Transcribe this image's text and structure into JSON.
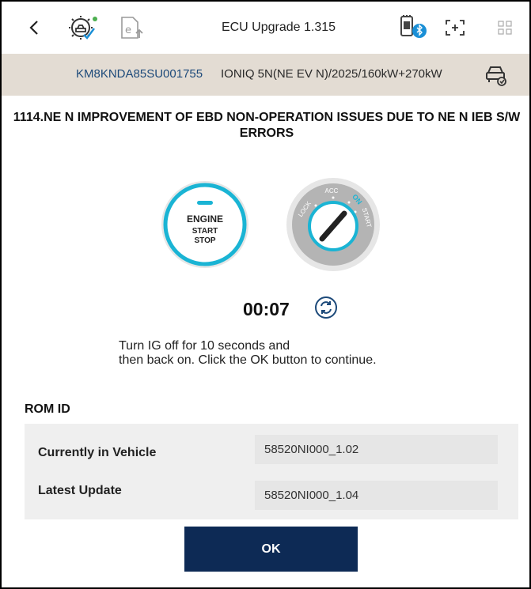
{
  "header": {
    "back_glyph": "<",
    "title": "ECU Upgrade 1.315",
    "icons": [
      "back-icon",
      "gear-car-check-icon",
      "e-upload-icon",
      "bluetooth-vci-icon",
      "screen-capture-icon",
      "grid-menu-icon"
    ]
  },
  "vehicle": {
    "vin": "KM8KNDA85SU001755",
    "description": "IONIQ 5N(NE EV N)/2025/160kW+270kW",
    "icon": "car-diagnostic-icon"
  },
  "procedure": {
    "heading": "1114.NE N IMPROVEMENT OF EBD NON-OPERATION ISSUES DUE TO NE N IEB S/W ERRORS"
  },
  "engine_button": {
    "line1": "ENGINE",
    "line2": "START",
    "line3": "STOP"
  },
  "ignition": {
    "positions": [
      "LOCK",
      "ACC",
      "ON",
      "START"
    ],
    "active": "ON"
  },
  "timer": {
    "value": "00:07",
    "icon": "refresh-icon"
  },
  "instruction": {
    "line1": "Turn IG off for 10 seconds and",
    "line2": "then back on. Click the OK button to continue."
  },
  "rom": {
    "label": "ROM ID",
    "rows": [
      {
        "label": "Currently in Vehicle",
        "value": "58520NI000_1.02"
      },
      {
        "label": "Latest Update",
        "value": "58520NI000_1.04"
      }
    ]
  },
  "actions": {
    "ok_label": "OK"
  },
  "colors": {
    "navy": "#0d2a55",
    "vin_blue": "#1d4a7a",
    "vehicle_bar": "#e3dcd3",
    "accent_teal": "#1ab4d4"
  }
}
